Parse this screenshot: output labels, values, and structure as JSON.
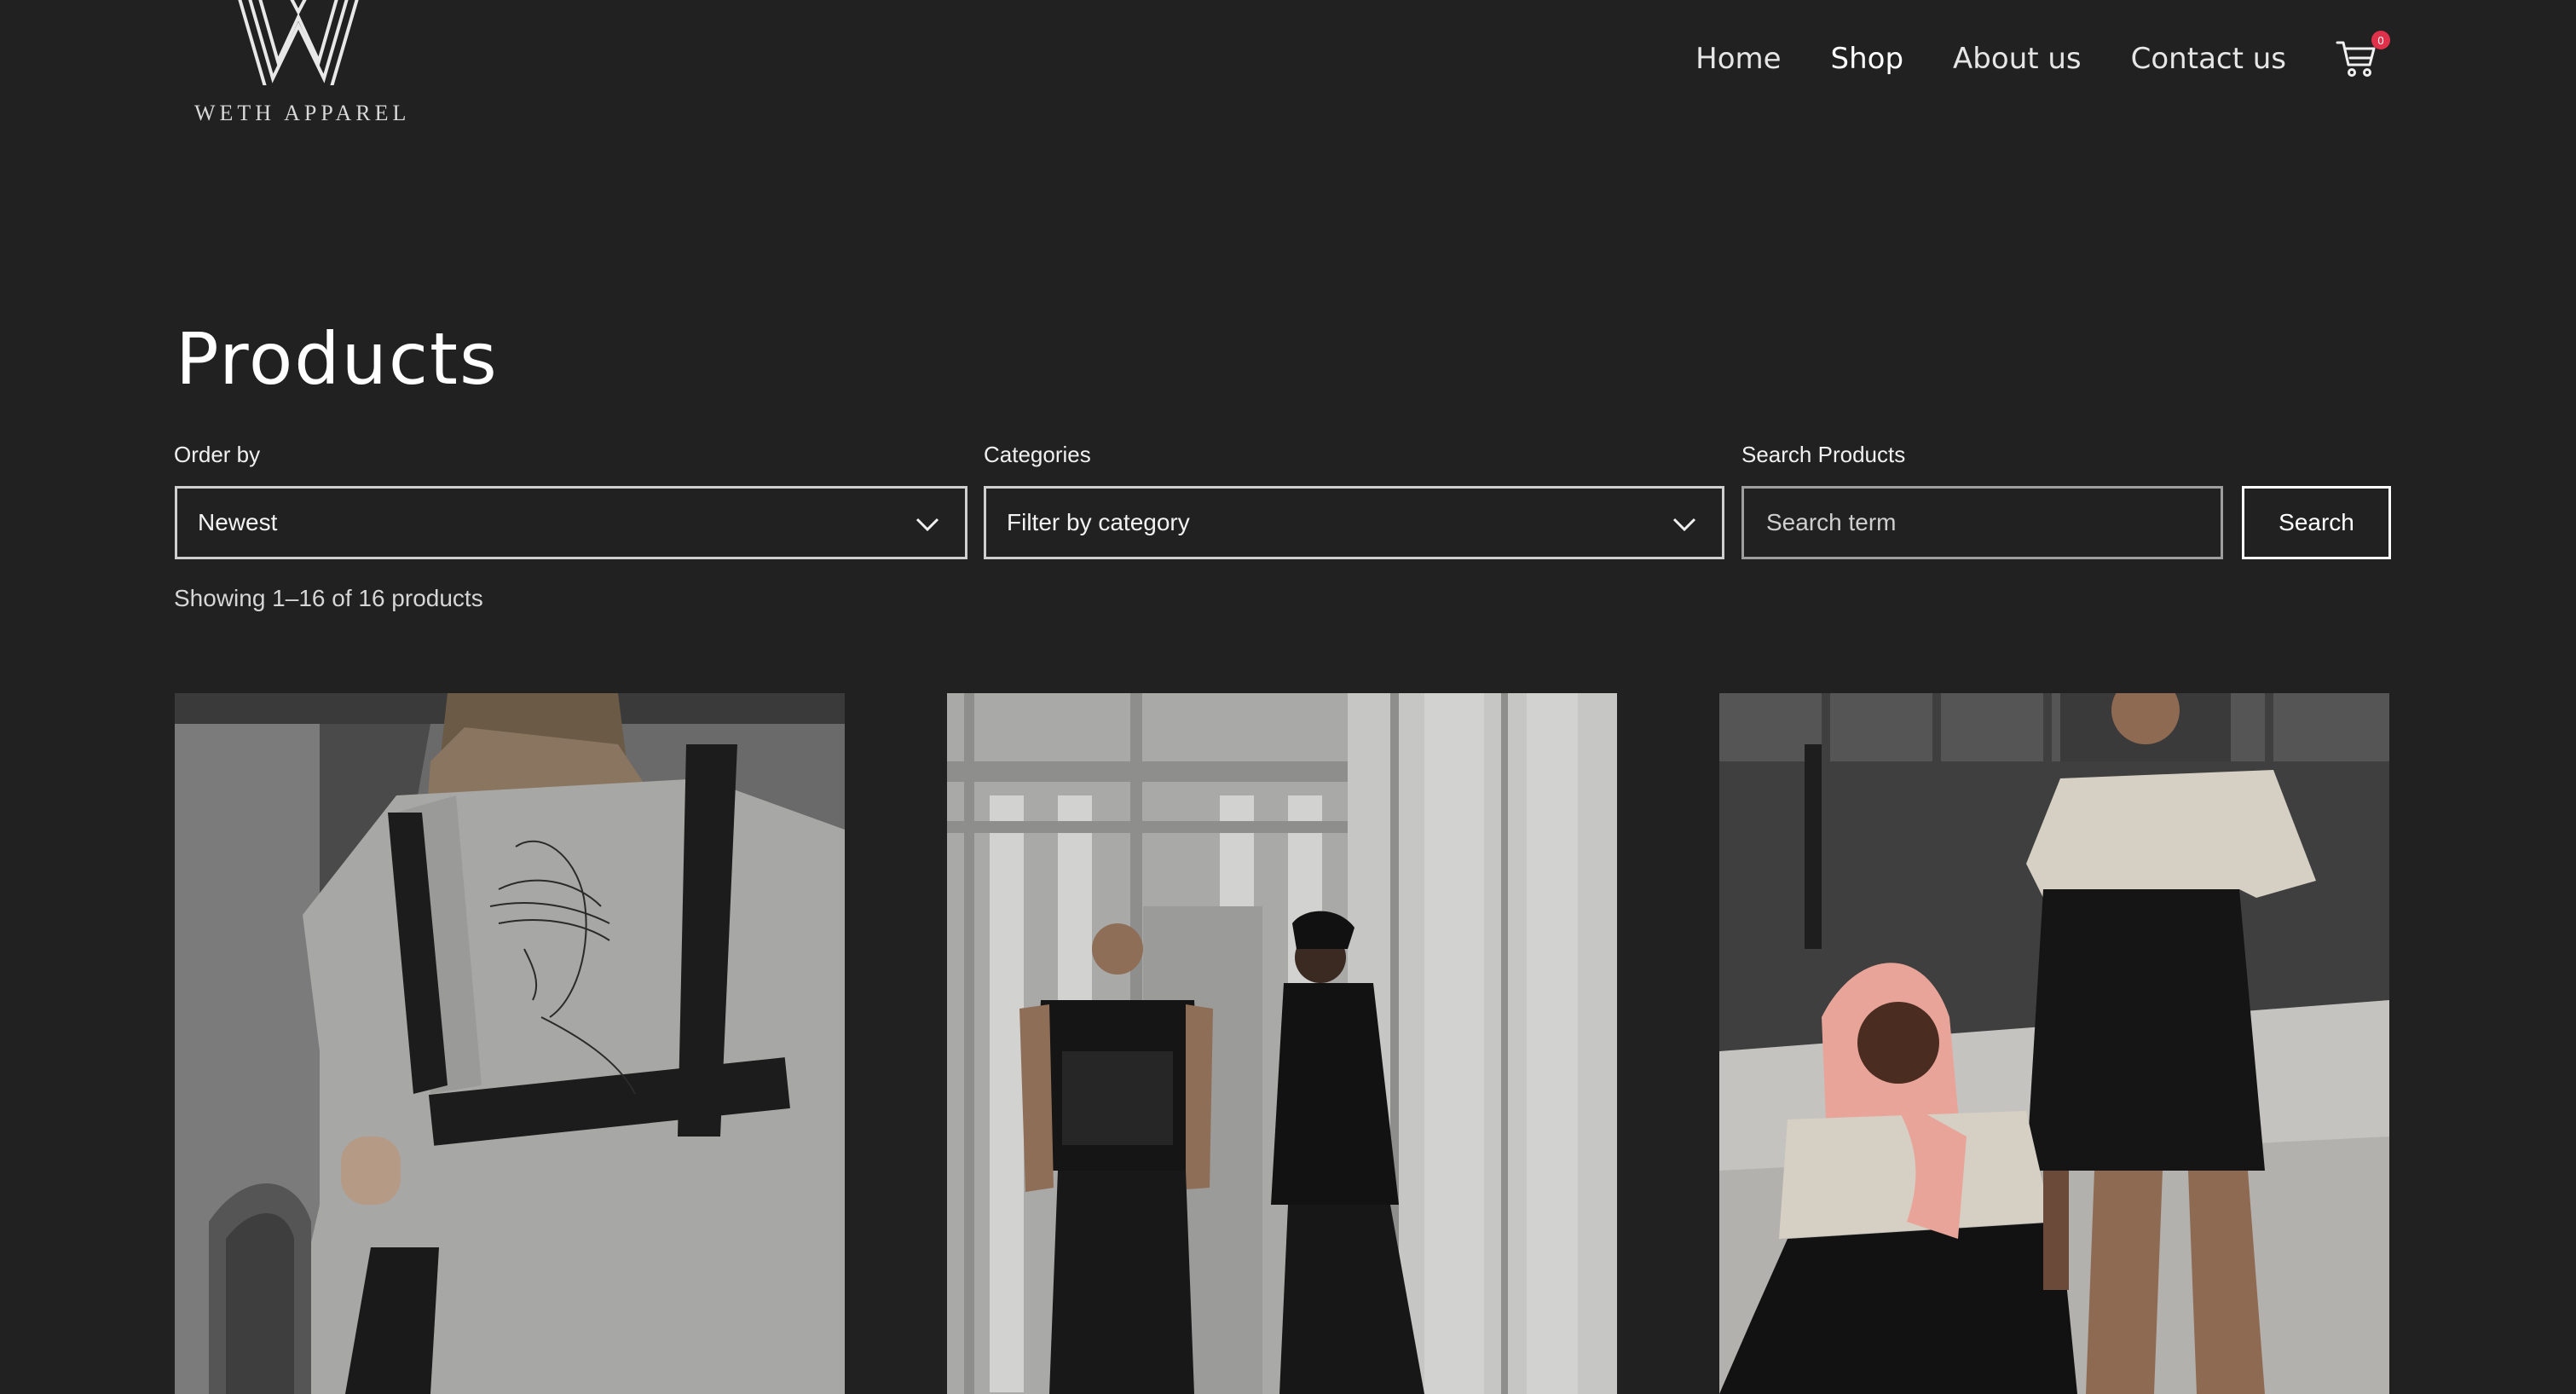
{
  "brand": {
    "name": "WETH APPAREL"
  },
  "nav": {
    "items": [
      {
        "label": "Home",
        "active": false
      },
      {
        "label": "Shop",
        "active": true
      },
      {
        "label": "About us",
        "active": false
      },
      {
        "label": "Contact us",
        "active": false
      }
    ],
    "cart_count": "0"
  },
  "page": {
    "title": "Products",
    "result_count": "Showing 1–16 of 16 products"
  },
  "filters": {
    "order_label": "Order by",
    "order_value": "Newest",
    "categories_label": "Categories",
    "categories_value": "Filter by category",
    "search_label": "Search Products",
    "search_placeholder": "Search term",
    "search_button": "Search"
  },
  "colors": {
    "background": "#212121",
    "text": "#ffffff",
    "badge": "#e0314b",
    "border": "#cfcfcf"
  },
  "icons": {
    "cart": "cart-icon",
    "chevron": "chevron-down-icon"
  }
}
